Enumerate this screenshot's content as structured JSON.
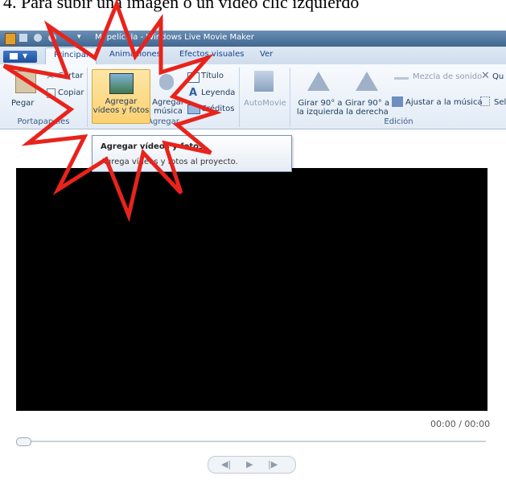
{
  "caption": "4.  Para subir una imagen o un video clic izquierdo",
  "window": {
    "title": "Mi película - Windows Live Movie Maker"
  },
  "tabs": [
    {
      "label": "Principal",
      "active": true
    },
    {
      "label": "Animaciones",
      "active": false
    },
    {
      "label": "Efectos visuales",
      "active": false
    },
    {
      "label": "Ver",
      "active": false
    }
  ],
  "ribbon": {
    "clipboard": {
      "paste": "Pegar",
      "cut": "Cortar",
      "copy": "Copiar",
      "group": "Portapapeles"
    },
    "add": {
      "add_videos_line1": "Agregar",
      "add_videos_line2": "vídeos y fotos",
      "add_music_line1": "Agregar",
      "add_music_line2": "música",
      "title": "Título",
      "caption": "Leyenda",
      "credits": "Créditos",
      "group": "Agregar"
    },
    "automovie": "AutoMovie",
    "editing": {
      "rotate_left_line1": "Girar 90° a",
      "rotate_left_line2": "la izquierda",
      "rotate_right_line1": "Girar 90° a",
      "rotate_right_line2": "la derecha",
      "sound_mix": "Mezcla de sonido",
      "fit_to_music": "Ajustar a la música",
      "remove": "Qu",
      "select": "Sel",
      "group": "Edición"
    }
  },
  "tooltip": {
    "title": "Agregar vídeos y fotos",
    "description": "Agrega vídeos y fotos al proyecto."
  },
  "player": {
    "timecode": "00:00 / 00:00",
    "seek_position": 0
  },
  "colors": {
    "highlight": "#fbd172",
    "annotation_star": "#e8231c",
    "titlebar": "#41668f"
  },
  "icons": [
    "app-menu-icon",
    "paste-icon",
    "cut-icon",
    "copy-icon",
    "add-videos-photos-icon",
    "add-music-icon",
    "title-icon",
    "caption-icon",
    "credits-icon",
    "automovie-icon",
    "rotate-left-icon",
    "rotate-right-icon",
    "sound-mix-icon",
    "fit-to-music-icon",
    "remove-icon",
    "select-icon",
    "previous-frame-icon",
    "play-icon",
    "next-frame-icon"
  ]
}
